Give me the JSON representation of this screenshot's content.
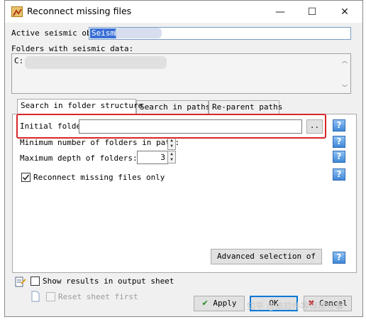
{
  "window": {
    "title": "Reconnect missing files",
    "minimize": "—",
    "maximize": "☐",
    "close": "✕"
  },
  "active_seismic": {
    "label": "Active seismic obj",
    "value": "Seism"
  },
  "folders": {
    "label": "Folders with seismic data:",
    "value": "C:"
  },
  "tabs": [
    {
      "label": "Search in folder structure"
    },
    {
      "label": "Search in paths"
    },
    {
      "label": "Re-parent paths"
    }
  ],
  "panel": {
    "initial_folder_label": "Initial folder:",
    "initial_folder_value": "",
    "browse_label": "..",
    "min_folders_label": "Minimum number of folders in path:",
    "min_folders_value": "",
    "max_depth_label": "Maximum depth of folders:",
    "max_depth_value": "3",
    "reconnect_only_label": "Reconnect missing files only",
    "reconnect_only_checked": true,
    "advanced_label": "Advanced selection of",
    "help": "?"
  },
  "bottom": {
    "show_results_label": "Show results in output sheet",
    "show_results_checked": false,
    "reset_sheet_label": "Reset sheet first",
    "reset_sheet_checked": false,
    "apply_label": "Apply",
    "ok_label": "OK",
    "cancel_label": "Cancel"
  },
  "watermark": "知乎 @搞软件等得那些事"
}
